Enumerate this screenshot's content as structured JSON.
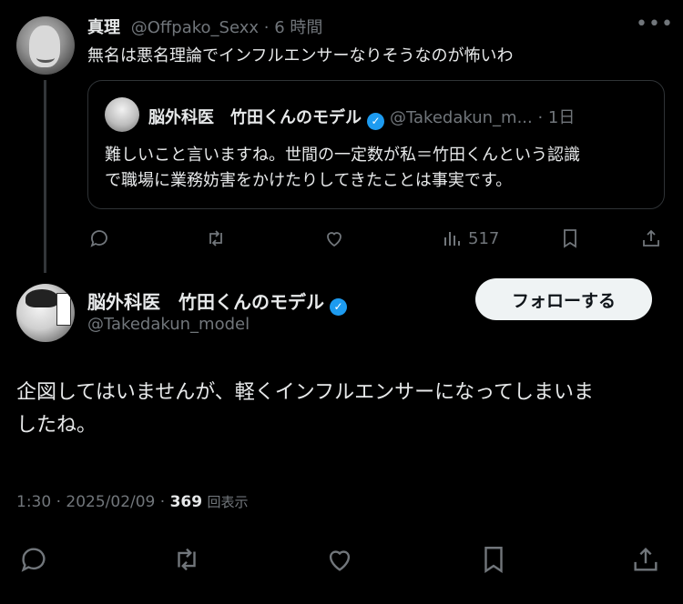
{
  "quoted_reply": {
    "display_name": "真理",
    "handle": "@Offpako_Sexx",
    "time": "· 6 時間",
    "more_icon": "more-horizontal-icon",
    "text": "無名は悪名理論でインフルエンサーなりそうなのが怖いわ",
    "quote": {
      "display_name": "脳外科医　竹田くんのモデル",
      "handle": "@Takedakun_m...",
      "time": "· 1日",
      "text_line1": "難しいこと言いますね。世間の一定数が私＝竹田くんという認識",
      "text_line2": "で職場に業務妨害をかけたりしてきたことは事実です。"
    },
    "actions": {
      "reply_icon": "reply-icon",
      "repost_icon": "repost-icon",
      "like_icon": "heart-icon",
      "views_icon": "views-icon",
      "views_count": "517",
      "bookmark_icon": "bookmark-icon",
      "share_icon": "share-icon"
    }
  },
  "main_tweet": {
    "display_name": "脳外科医　竹田くんのモデル",
    "handle": "@Takedakun_model",
    "follow_label": "フォローする",
    "text_line1": "企図してはいませんが、軽くインフルエンサーになってしまいま",
    "text_line2": "したね。",
    "time": "1:30 · 2025/02/09 ·",
    "views_count": "369",
    "views_label": "回表示"
  },
  "colors": {
    "background": "#000000",
    "text": "#e7e9ea",
    "muted": "#71767b",
    "verified": "#1d9bf0",
    "border": "#2f3336"
  }
}
